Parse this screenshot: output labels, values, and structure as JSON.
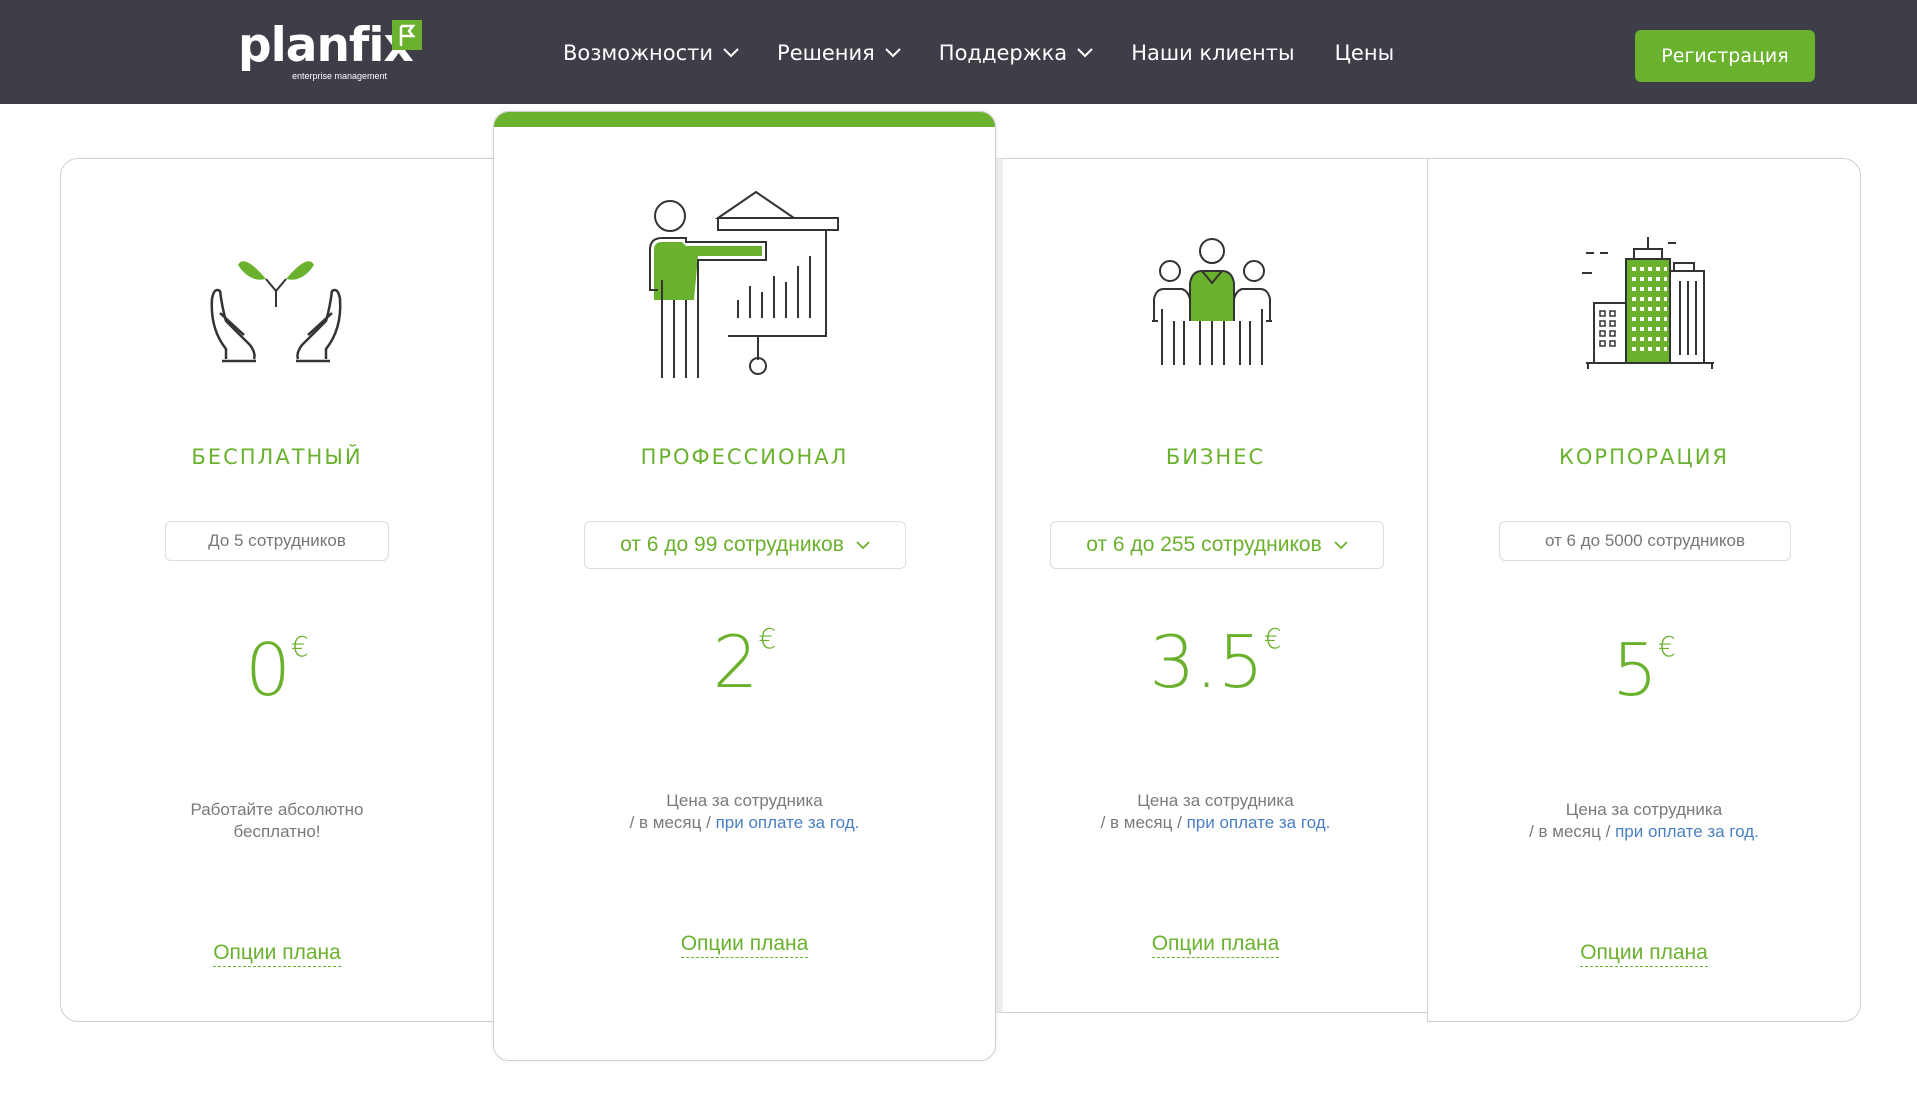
{
  "header": {
    "logo_text": "planfix",
    "logo_subtitle": "enterprise management",
    "nav": [
      {
        "label": "Возможности",
        "dropdown": true
      },
      {
        "label": "Решения",
        "dropdown": true
      },
      {
        "label": "Поддержка",
        "dropdown": true
      },
      {
        "label": "Наши клиенты",
        "dropdown": false
      },
      {
        "label": "Цены",
        "dropdown": false
      }
    ],
    "register_label": "Регистрация"
  },
  "colors": {
    "accent": "#6ab12e",
    "header_bg": "#3d3e47",
    "link": "#4a7fc1"
  },
  "plans": {
    "free": {
      "icon": "plant-hands-icon",
      "name": "БЕСПЛАТНЫЙ",
      "employees": "До 5 сотрудников",
      "price": "0",
      "currency": "€",
      "desc_line1": "Работайте абсолютно",
      "desc_line2": "бесплатно!",
      "options_label": "Опции плана"
    },
    "pro": {
      "icon": "presenter-chart-icon",
      "name": "ПРОФЕССИОНАЛ",
      "employees": "от 6 до 99 сотрудников",
      "price": "2",
      "currency": "€",
      "desc_line1": "Цена за сотрудника",
      "desc_prefix": "/ в месяц /",
      "desc_link": "при оплате за год.",
      "options_label": "Опции плана"
    },
    "business": {
      "icon": "team-icon",
      "name": "БИЗНЕС",
      "employees": "от 6 до 255 сотрудников",
      "price": "3.5",
      "currency": "€",
      "desc_line1": "Цена за сотрудника",
      "desc_prefix": "/ в месяц /",
      "desc_link": "при оплате за год.",
      "options_label": "Опции плана"
    },
    "corporation": {
      "icon": "buildings-icon",
      "name": "КОРПОРАЦИЯ",
      "employees": "от 6 до 5000 сотрудников",
      "price": "5",
      "currency": "€",
      "desc_line1": "Цена за сотрудника",
      "desc_prefix": "/ в месяц /",
      "desc_link": "при оплате за год.",
      "options_label": "Опции плана"
    }
  }
}
